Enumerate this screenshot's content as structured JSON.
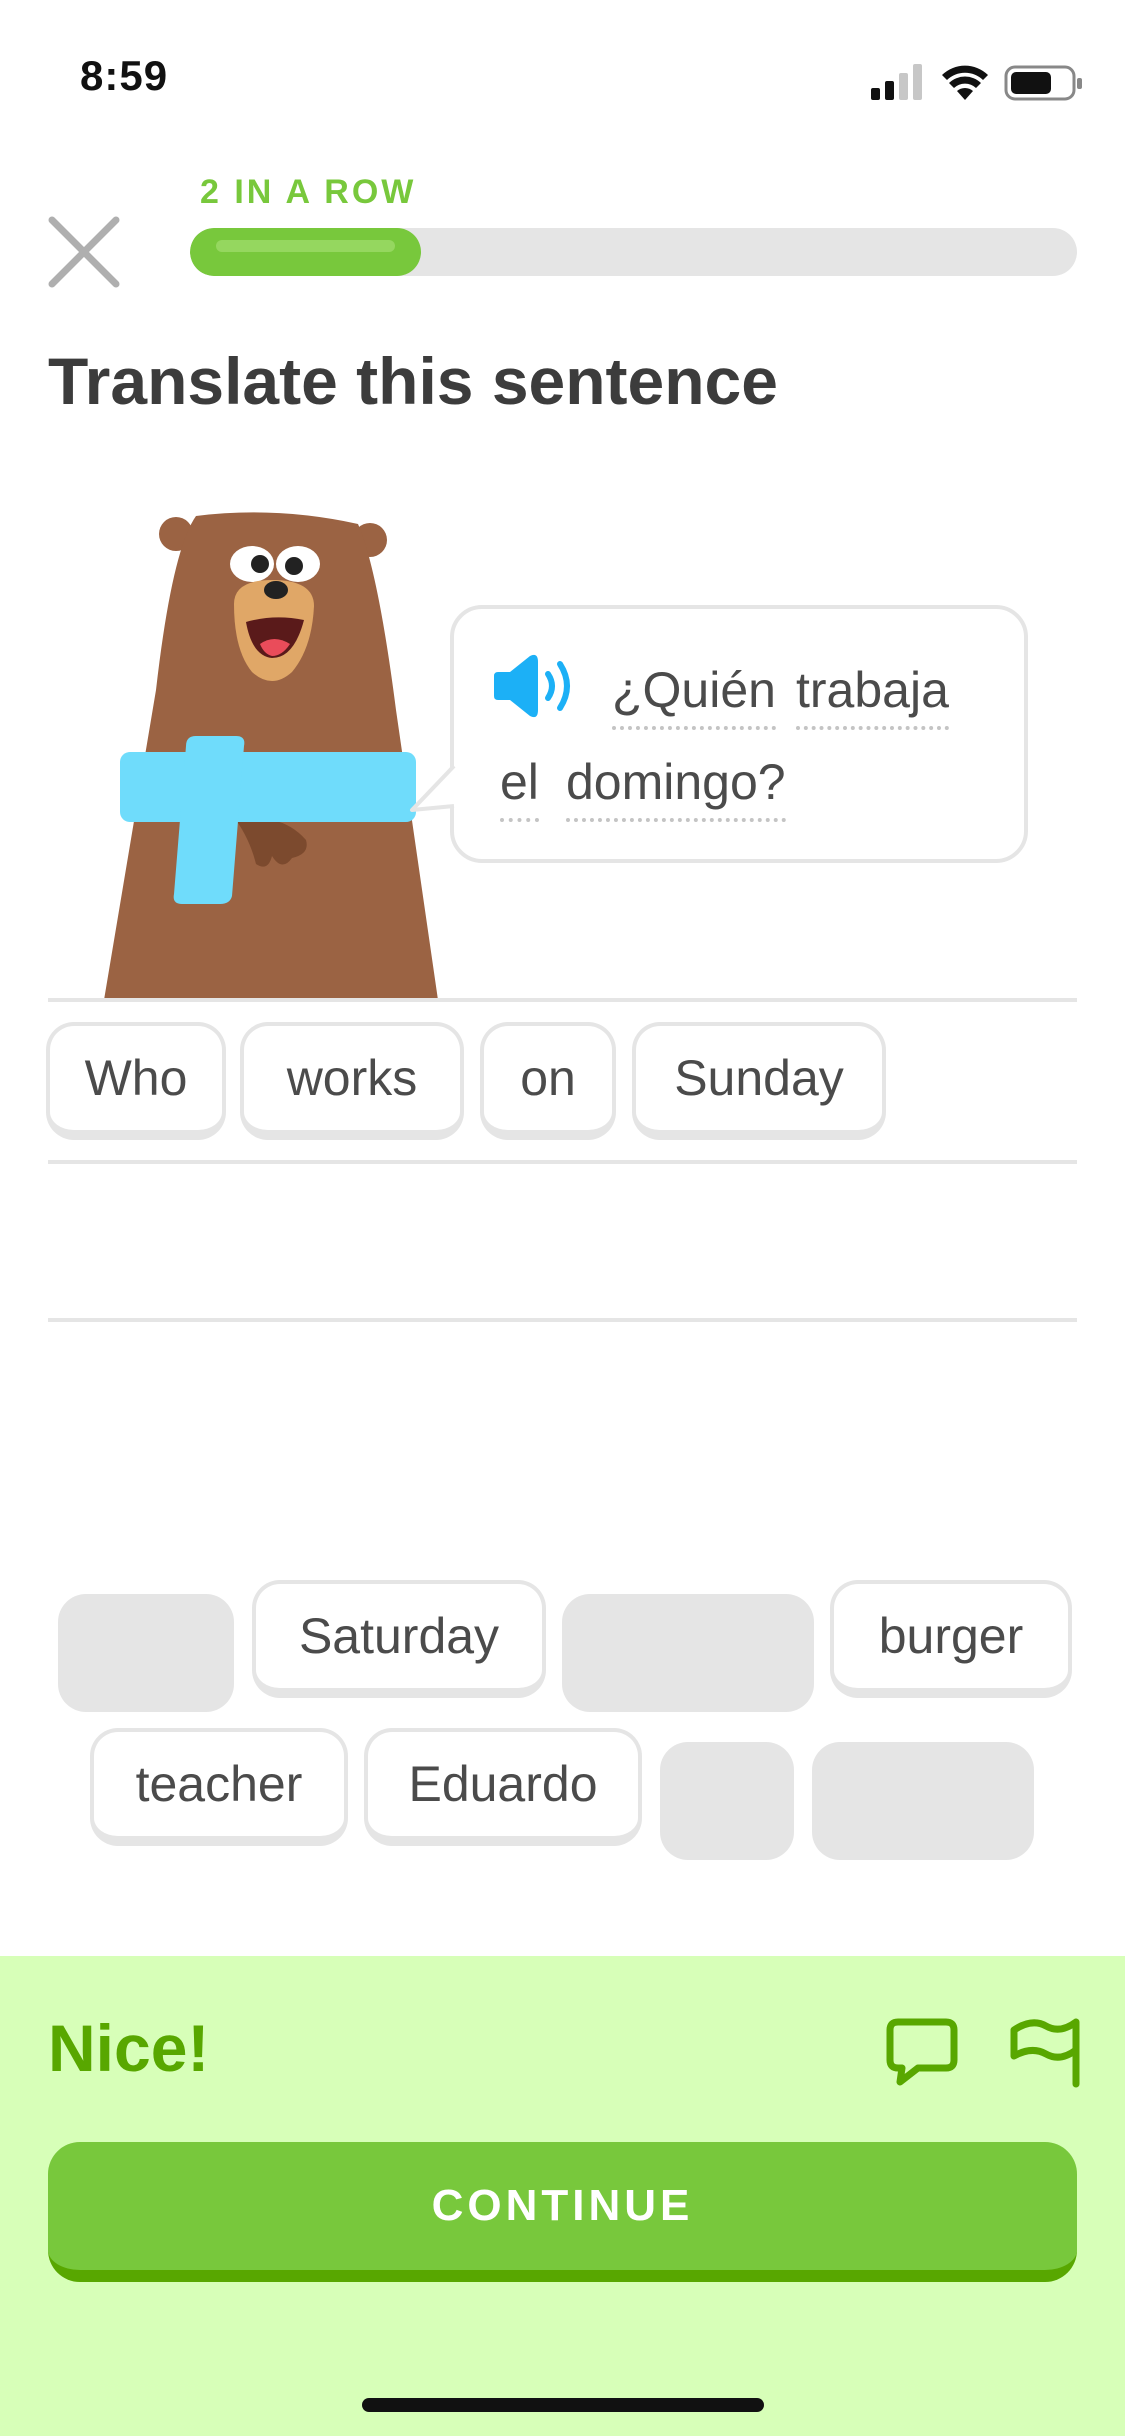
{
  "status_bar": {
    "time": "8:59"
  },
  "header": {
    "streak_label": "2 IN A ROW",
    "progress": 0.26
  },
  "prompt": {
    "title": "Translate this sentence"
  },
  "bubble": {
    "words": [
      "¿Quién",
      "trabaja",
      "el",
      "domingo?"
    ]
  },
  "answer": {
    "chips": [
      "Who",
      "works",
      "on",
      "Sunday"
    ]
  },
  "word_bank": {
    "chips": [
      "Saturday",
      "burger",
      "teacher",
      "Eduardo"
    ]
  },
  "feedback": {
    "message": "Nice!",
    "continue_label": "CONTINUE"
  },
  "colors": {
    "accent": "#78c83c",
    "accent_dark": "#58a700",
    "sheet": "#d7ffb8",
    "bubble_speaker": "#1cb0f6"
  }
}
